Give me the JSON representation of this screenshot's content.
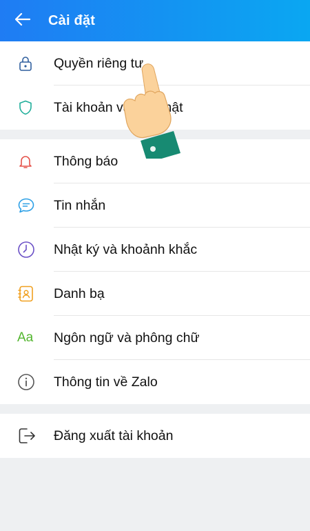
{
  "header": {
    "title": "Cài đặt"
  },
  "sections": [
    {
      "items": [
        {
          "id": "privacy",
          "icon": "lock-icon",
          "label": "Quyền riêng tư"
        },
        {
          "id": "account-security",
          "icon": "shield-icon",
          "label": "Tài khoản và bảo mật"
        }
      ]
    },
    {
      "items": [
        {
          "id": "notifications",
          "icon": "bell-icon",
          "label": "Thông báo"
        },
        {
          "id": "messages",
          "icon": "chat-bubble-icon",
          "label": "Tin nhắn"
        },
        {
          "id": "diary",
          "icon": "clock-icon",
          "label": "Nhật ký và khoảnh khắc"
        },
        {
          "id": "contacts",
          "icon": "contact-book-icon",
          "label": "Danh bạ"
        },
        {
          "id": "language-font",
          "icon": "text-aa-icon",
          "icon_text": "Aa",
          "label": "Ngôn ngữ và phông chữ"
        },
        {
          "id": "about",
          "icon": "info-icon",
          "label": "Thông tin về Zalo"
        }
      ]
    },
    {
      "items": [
        {
          "id": "logout",
          "icon": "logout-icon",
          "label": "Đăng xuất tài khoản"
        }
      ]
    }
  ],
  "colors": {
    "header_gradient_start": "#1f7cf3",
    "header_gradient_end": "#0aa7f2",
    "lock": "#2f5f9e",
    "shield": "#1fae9a",
    "bell": "#e5534b",
    "chat": "#2b9fe6",
    "clock": "#6a4fc6",
    "contacts": "#f0a020",
    "aa": "#53b62f",
    "info": "#555555",
    "logout": "#333333"
  }
}
